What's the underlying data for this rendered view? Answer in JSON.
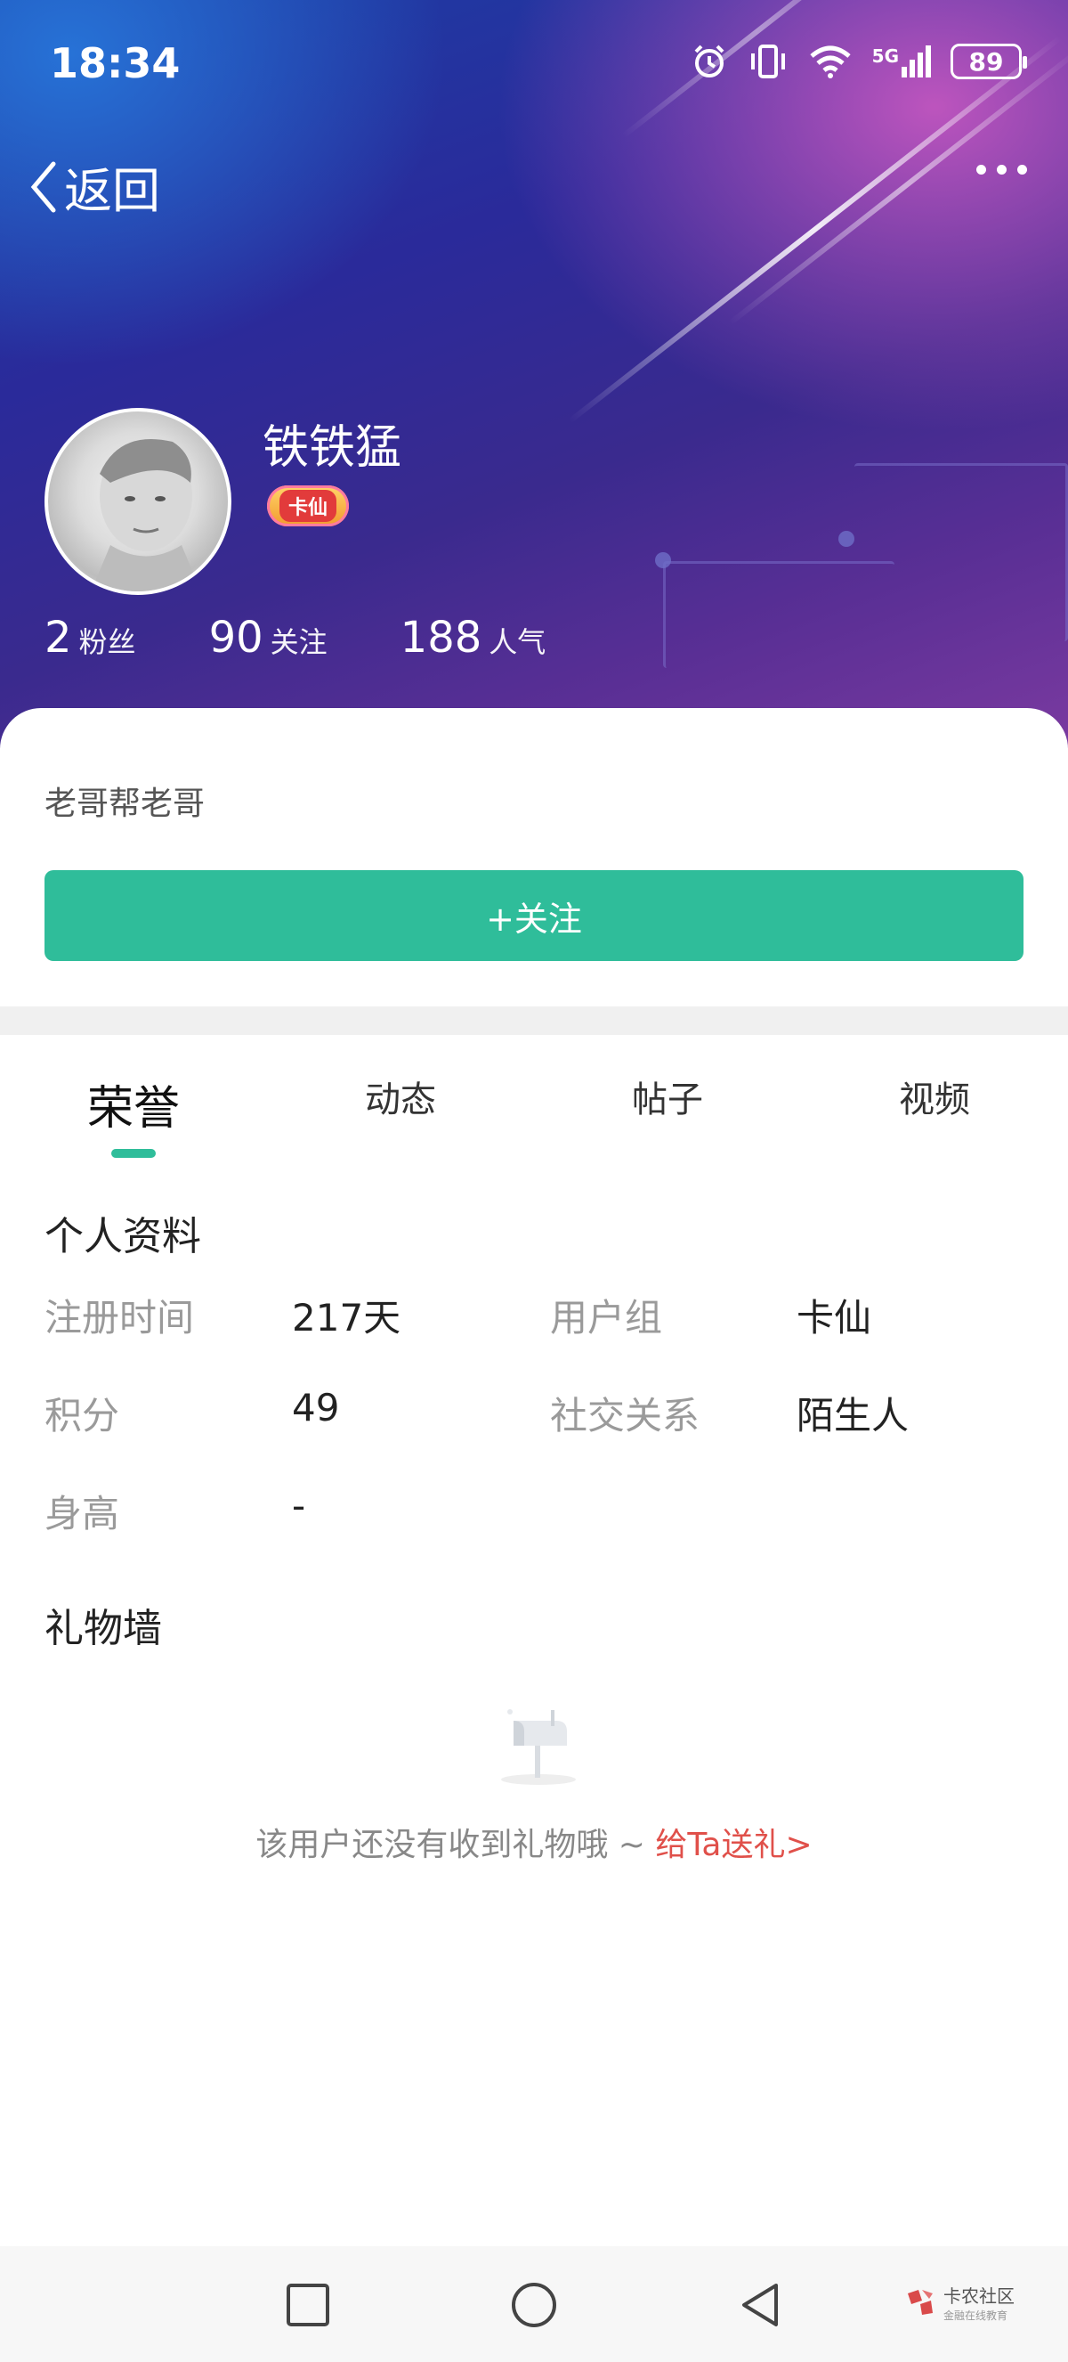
{
  "status_bar": {
    "time": "18:34",
    "network": "5G",
    "battery": "89"
  },
  "nav": {
    "back_label": "返回"
  },
  "profile": {
    "username": "铁铁猛",
    "badge": "卡仙",
    "stats": [
      {
        "value": "2",
        "label": "粉丝"
      },
      {
        "value": "90",
        "label": "关注"
      },
      {
        "value": "188",
        "label": "人气"
      }
    ],
    "bio": "老哥帮老哥",
    "follow_button": "+关注"
  },
  "tabs": [
    {
      "label": "荣誉",
      "active": true
    },
    {
      "label": "动态",
      "active": false
    },
    {
      "label": "帖子",
      "active": false
    },
    {
      "label": "视频",
      "active": false
    }
  ],
  "personal_info": {
    "title": "个人资料",
    "fields": [
      {
        "label": "注册时间",
        "value": "217天"
      },
      {
        "label": "用户组",
        "value": "卡仙"
      },
      {
        "label": "积分",
        "value": "49"
      },
      {
        "label": "社交关系",
        "value": "陌生人"
      },
      {
        "label": "身高",
        "value": "-"
      }
    ]
  },
  "gift_wall": {
    "title": "礼物墙",
    "empty_text": "该用户还没有收到礼物哦 ~ ",
    "send_link": "给Ta送礼>"
  },
  "watermark": {
    "name": "卡农社区",
    "tagline": "金融在线教育"
  },
  "colors": {
    "accent": "#2fbd9a",
    "link": "#e0504a"
  }
}
